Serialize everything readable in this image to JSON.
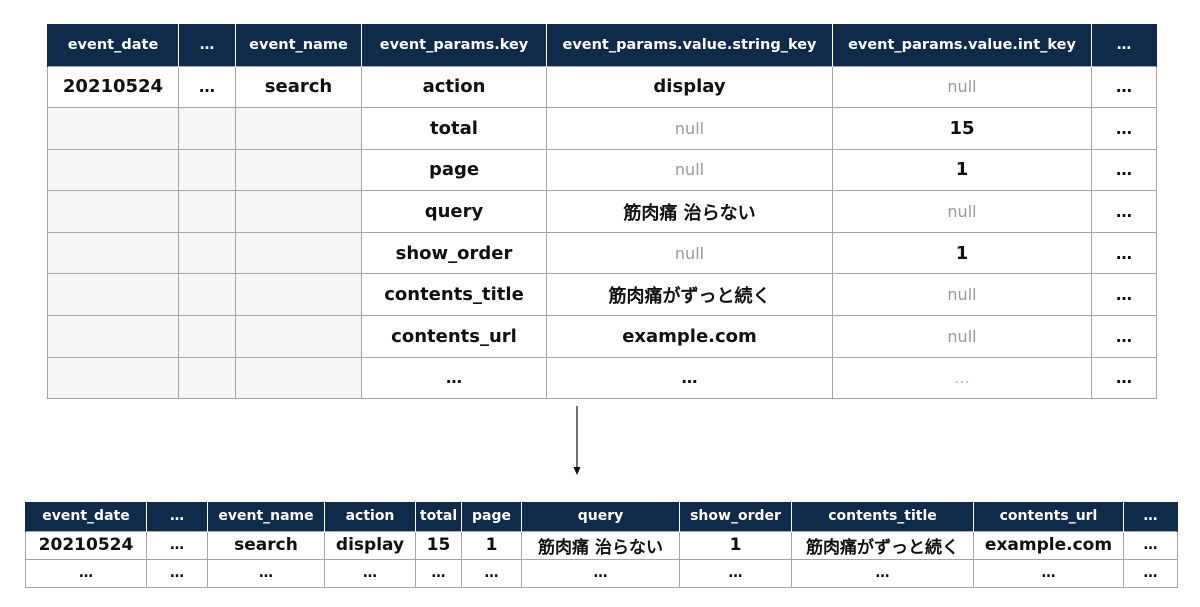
{
  "nested_table": {
    "headers": [
      "event_date",
      "…",
      "event_name",
      "event_params.key",
      "event_params.value.string_key",
      "event_params.value.int_key",
      "…"
    ],
    "rows": [
      [
        "20210524",
        "…",
        "search",
        "action",
        "display",
        "null",
        "…"
      ],
      [
        "",
        "",
        "",
        "total",
        "null",
        "15",
        "…"
      ],
      [
        "",
        "",
        "",
        "page",
        "null",
        "1",
        "…"
      ],
      [
        "",
        "",
        "",
        "query",
        "筋肉痛 治らない",
        "null",
        "…"
      ],
      [
        "",
        "",
        "",
        "show_order",
        "null",
        "1",
        "…"
      ],
      [
        "",
        "",
        "",
        "contents_title",
        "筋肉痛がずっと続く",
        "null",
        "…"
      ],
      [
        "",
        "",
        "",
        "contents_url",
        "example.com",
        "null",
        "…"
      ],
      [
        "",
        "",
        "",
        "…",
        "…",
        "…",
        "…"
      ]
    ]
  },
  "flattened_table": {
    "headers": [
      "event_date",
      "…",
      "event_name",
      "action",
      "total",
      "page",
      "query",
      "show_order",
      "contents_title",
      "contents_url",
      "…"
    ],
    "rows": [
      [
        "20210524",
        "…",
        "search",
        "display",
        "15",
        "1",
        "筋肉痛 治らない",
        "1",
        "筋肉痛がずっと続く",
        "example.com",
        "…"
      ],
      [
        "…",
        "…",
        "…",
        "…",
        "…",
        "…",
        "…",
        "…",
        "…",
        "…",
        "…"
      ]
    ]
  },
  "colors": {
    "header_bg": "#102a4a",
    "header_text": "#ffffff",
    "empty_cell_bg": "#f6f6f6",
    "null_text": "#9a9a9a",
    "grid_line": "#a6a6a6"
  }
}
